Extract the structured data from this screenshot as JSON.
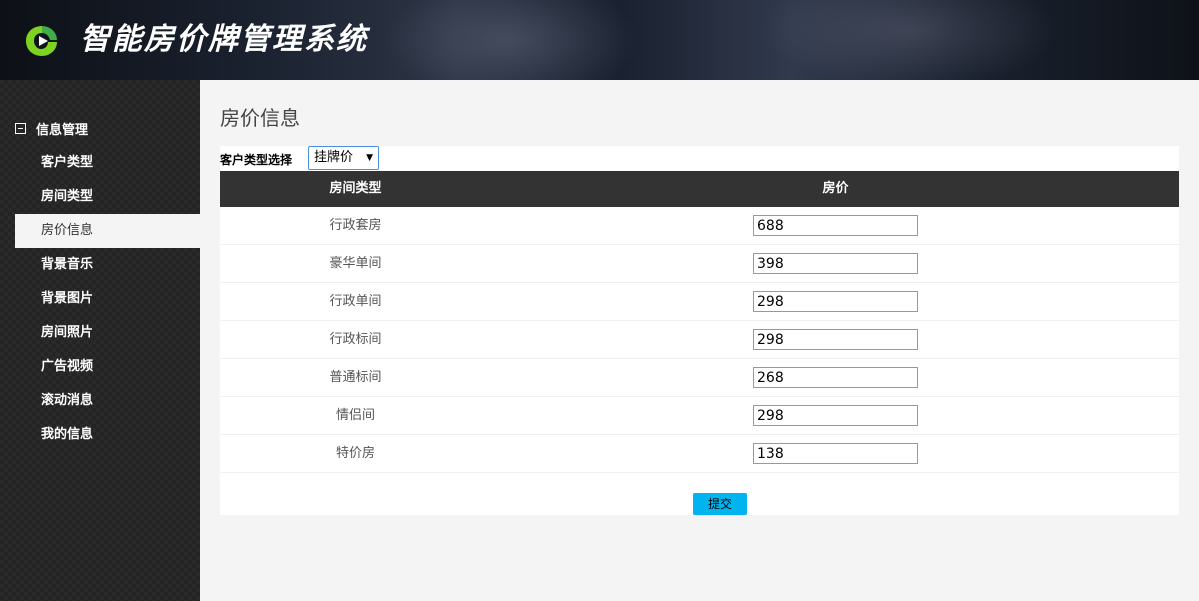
{
  "header": {
    "title": "智能房价牌管理系统",
    "logo_icon": "play-logo-icon"
  },
  "sidebar": {
    "group_label": "信息管理",
    "items": [
      {
        "label": "客户类型",
        "active": false
      },
      {
        "label": "房间类型",
        "active": false
      },
      {
        "label": "房价信息",
        "active": true
      },
      {
        "label": "背景音乐",
        "active": false
      },
      {
        "label": "背景图片",
        "active": false
      },
      {
        "label": "房间照片",
        "active": false
      },
      {
        "label": "广告视频",
        "active": false
      },
      {
        "label": "滚动消息",
        "active": false
      },
      {
        "label": "我的信息",
        "active": false
      }
    ]
  },
  "main": {
    "page_title": "房价信息",
    "filter": {
      "label": "客户类型选择",
      "selected": "挂牌价"
    },
    "table": {
      "headers": {
        "type": "房间类型",
        "price": "房价"
      },
      "rows": [
        {
          "type": "行政套房",
          "price": "688"
        },
        {
          "type": "豪华单间",
          "price": "398"
        },
        {
          "type": "行政单间",
          "price": "298"
        },
        {
          "type": "行政标间",
          "price": "298"
        },
        {
          "type": "普通标间",
          "price": "268"
        },
        {
          "type": "情侣间",
          "price": "298"
        },
        {
          "type": "特价房",
          "price": "138"
        }
      ]
    },
    "submit_label": "提交"
  },
  "colors": {
    "sidebar_bg": "#2a2a2a",
    "table_header_bg": "#333333",
    "submit_bg": "#00b4f0",
    "select_border": "#4a90e2"
  }
}
